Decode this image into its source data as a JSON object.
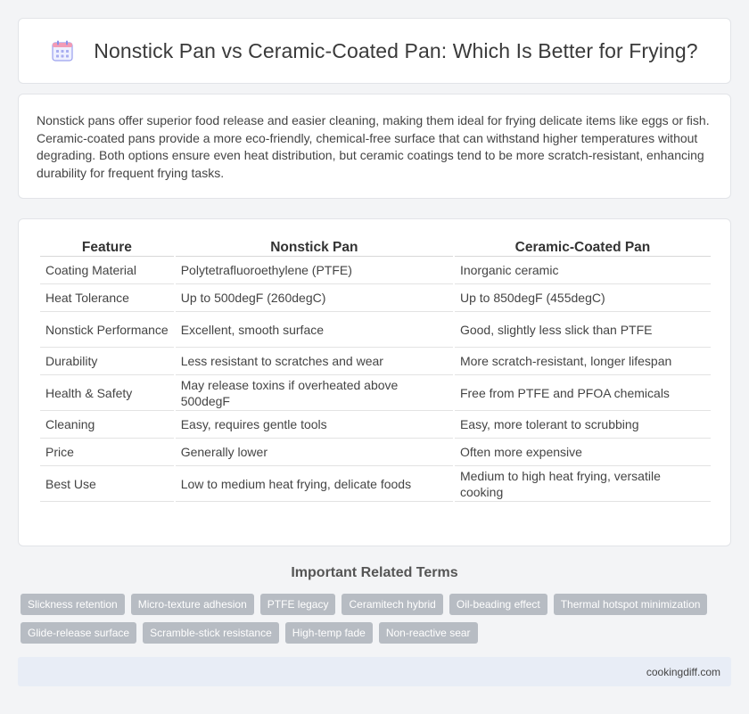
{
  "header": {
    "icon": "calendar-icon",
    "title": "Nonstick Pan vs Ceramic-Coated Pan: Which Is Better for Frying?"
  },
  "intro": {
    "text": "Nonstick pans offer superior food release and easier cleaning, making them ideal for frying delicate items like eggs or fish. Ceramic-coated pans provide a more eco-friendly, chemical-free surface that can withstand higher temperatures without degrading. Both options ensure even heat distribution, but ceramic coatings tend to be more scratch-resistant, enhancing durability for frequent frying tasks."
  },
  "table": {
    "headers": [
      "Feature",
      "Nonstick Pan",
      "Ceramic-Coated Pan"
    ],
    "rows": [
      [
        "Coating Material",
        "Polytetrafluoroethylene (PTFE)",
        "Inorganic ceramic"
      ],
      [
        "Heat Tolerance",
        "Up to 500degF (260degC)",
        "Up to 850degF (455degC)"
      ],
      [
        "Nonstick Performance",
        "Excellent, smooth surface",
        "Good, slightly less slick than PTFE"
      ],
      [
        "Durability",
        "Less resistant to scratches and wear",
        "More scratch-resistant, longer lifespan"
      ],
      [
        "Health & Safety",
        "May release toxins if overheated above 500degF",
        "Free from PTFE and PFOA chemicals"
      ],
      [
        "Cleaning",
        "Easy, requires gentle tools",
        "Easy, more tolerant to scrubbing"
      ],
      [
        "Price",
        "Generally lower",
        "Often more expensive"
      ],
      [
        "Best Use",
        "Low to medium heat frying, delicate foods",
        "Medium to high heat frying, versatile cooking"
      ]
    ]
  },
  "related": {
    "title": "Important Related Terms",
    "tags": [
      "Slickness retention",
      "Micro-texture adhesion",
      "PTFE legacy",
      "Ceramitech hybrid",
      "Oil-beading effect",
      "Thermal hotspot minimization",
      "Glide-release surface",
      "Scramble-stick resistance",
      "High-temp fade",
      "Non-reactive sear"
    ]
  },
  "footer": {
    "site": "cookingdiff.com"
  },
  "colors": {
    "tag_bg": "#b7bcc3",
    "footer_bg": "#e8edf6",
    "icon_accent": "#8a8fe8"
  }
}
